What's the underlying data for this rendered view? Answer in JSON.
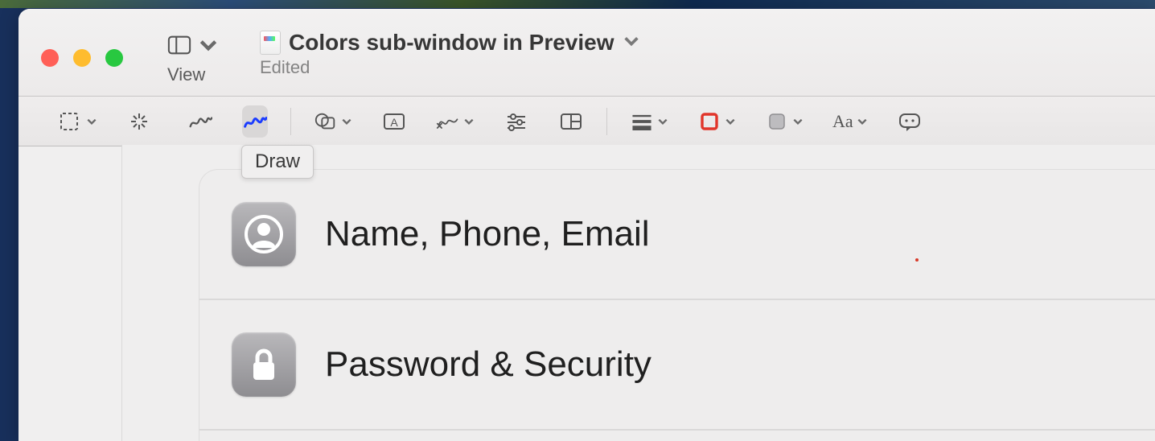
{
  "window": {
    "title": "Colors sub-window in Preview",
    "status": "Edited",
    "view_label": "View"
  },
  "tooltip": {
    "draw": "Draw"
  },
  "toolbar": {
    "selection": "selection-tool",
    "instant_alpha": "instant-alpha",
    "sketch": "sketch-tool",
    "draw": "draw-tool",
    "shapes": "shapes-tool",
    "text": "text-tool",
    "sign": "sign-tool",
    "adjust": "adjust-color",
    "crop": "crop-tool",
    "line_style": "line-style",
    "border_color": "border-color",
    "fill_color": "fill-color",
    "font": "font-style",
    "annotate": "annotate-tool"
  },
  "content": {
    "rows": [
      {
        "icon": "person-icon",
        "label": "Name, Phone, Email"
      },
      {
        "icon": "lock-icon",
        "label": "Password & Security"
      }
    ]
  }
}
